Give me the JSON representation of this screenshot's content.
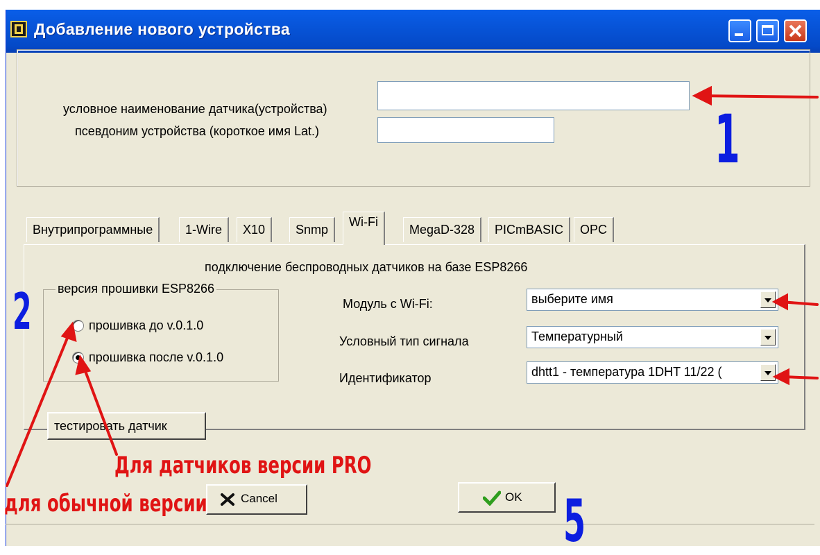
{
  "window": {
    "title": "Добавление нового устройства"
  },
  "device_section": {
    "name_label": "условное наименование датчика(устройства)",
    "name_value": "",
    "alias_label": "псевдоним устройства (короткое имя Lat.)",
    "alias_value": ""
  },
  "tabs": [
    {
      "label": "Внутрипрограммные",
      "active": false
    },
    {
      "label": "1-Wire",
      "active": false
    },
    {
      "label": "X10",
      "active": false
    },
    {
      "label": "Snmp",
      "active": false
    },
    {
      "label": "Wi-Fi",
      "active": true
    },
    {
      "label": "MegaD-328",
      "active": false
    },
    {
      "label": "PICmBASIC",
      "active": false
    },
    {
      "label": "OPC",
      "active": false
    }
  ],
  "wifi_panel": {
    "heading": "подключение беспроводных датчиков на базе ESP8266",
    "firmware_group": {
      "legend": "версия прошивки ESP8266",
      "options": [
        {
          "label": "прошивка до v.0.1.0",
          "checked": false
        },
        {
          "label": "прошивка после v.0.1.0",
          "checked": true
        }
      ]
    },
    "module_label": "Модуль с Wi-Fi:",
    "module_value": "выберите имя",
    "signal_type_label": "Условный тип  сигнала",
    "signal_type_value": "Температурный",
    "identifier_label": "Идентификатор",
    "identifier_value": "dhtt1 - температура 1DHT 11/22 (",
    "test_button": "тестировать датчик"
  },
  "buttons": {
    "cancel": "Cancel",
    "ok": "OK"
  },
  "annotations": {
    "num_1": "1",
    "num_2": "2",
    "num_5": "5",
    "pro_note": "Для датчиков версии PRO",
    "regular_note": "для обычной версии"
  },
  "colors": {
    "titlebar": "#0754d8",
    "window_bg": "#ece9d8",
    "annotation_red": "#e01414",
    "annotation_blue": "#0c1ee0"
  }
}
